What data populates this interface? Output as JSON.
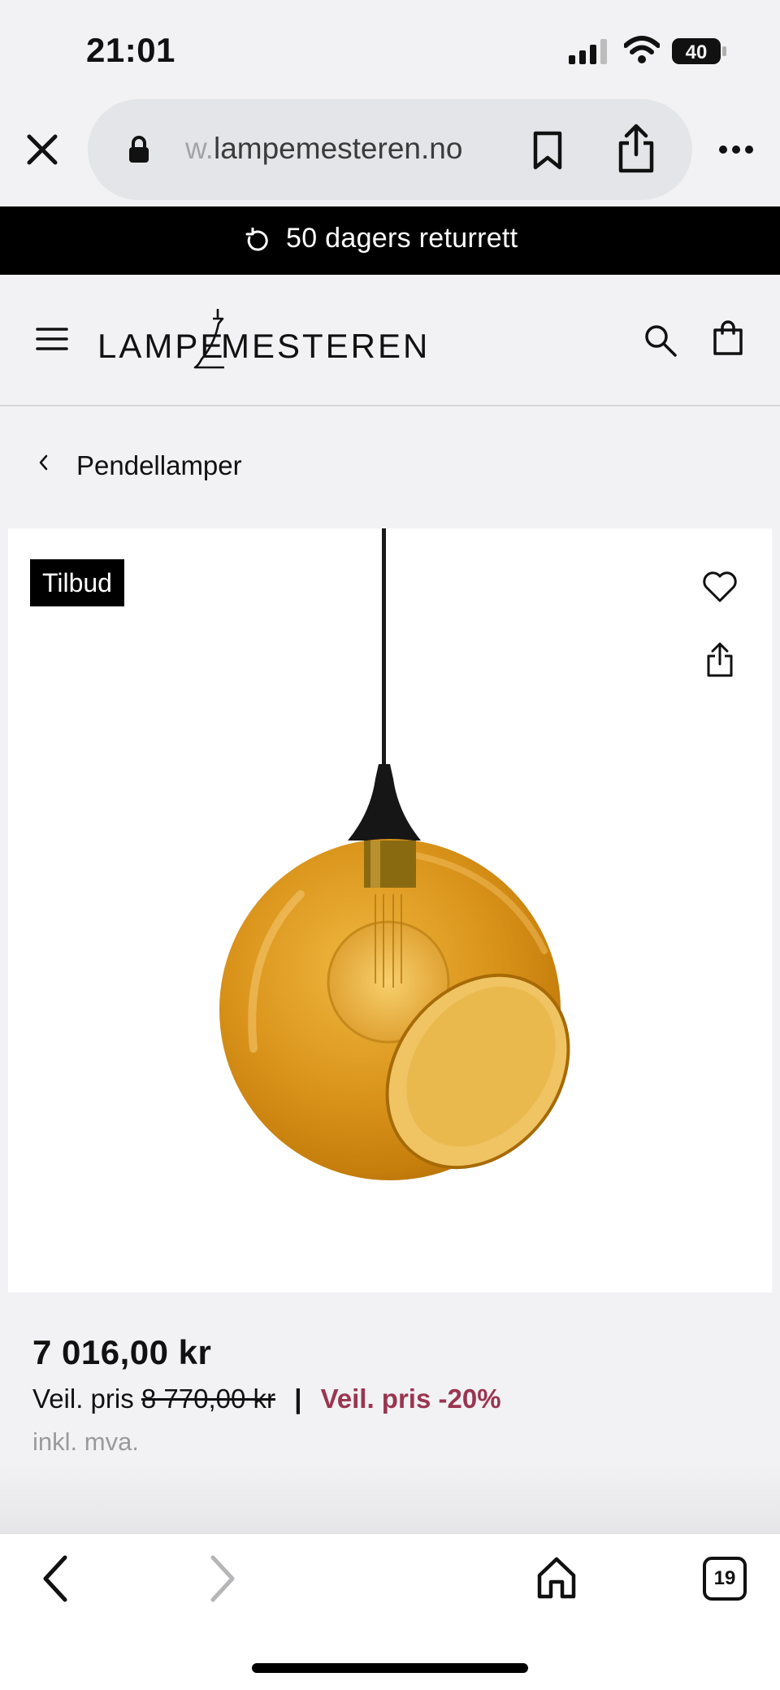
{
  "status_bar": {
    "time": "21:01",
    "battery": "40"
  },
  "browser": {
    "url_faded": "w.",
    "url_main": "lampemesteren.no",
    "tab_count": "19"
  },
  "promo": {
    "text": "50 dagers returrett"
  },
  "header": {
    "logo_part1": "LAMPE",
    "logo_part2": "MESTEREN"
  },
  "breadcrumb": {
    "label": "Pendellamper"
  },
  "product": {
    "badge": "Tilbud"
  },
  "pricing": {
    "price": "7 016,00 kr",
    "rec_label": "Veil. pris",
    "rec_price": "8 770,00 kr",
    "separator": "|",
    "discount": "Veil. pris -20%",
    "tax_note": "inkl. mva."
  },
  "colors": {
    "discount": "#9a3550",
    "lamp_glass": "#d9931a",
    "banner": "#000000"
  },
  "icons": [
    "close-icon",
    "lock-icon",
    "bookmark-icon",
    "share-icon",
    "more-icon",
    "return-icon",
    "menu-icon",
    "search-icon",
    "bag-icon",
    "chevron-left-icon",
    "heart-icon",
    "back-icon",
    "forward-icon",
    "home-icon",
    "tabs-icon"
  ]
}
